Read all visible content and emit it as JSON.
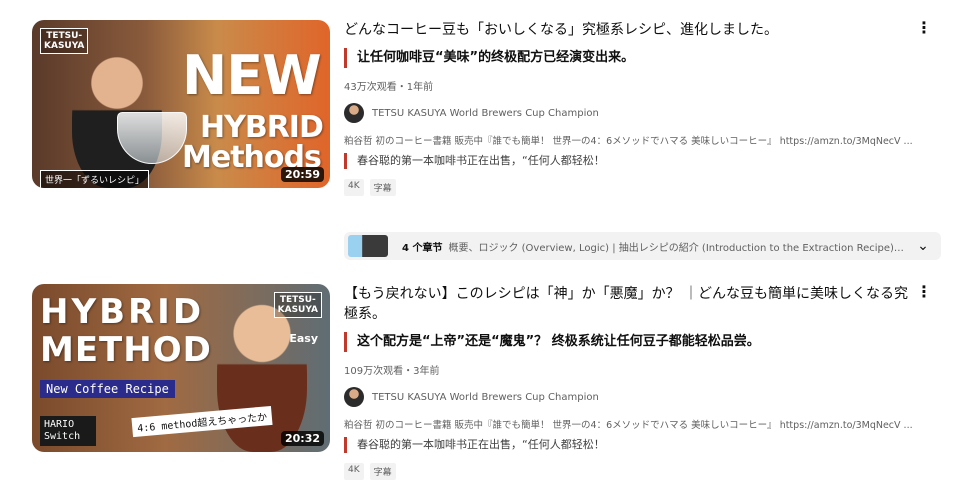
{
  "results": [
    {
      "thumbnail": {
        "brand_badge": "TETSU-\nKASUYA",
        "text_line1": "NEW",
        "text_line2": "HYBRID",
        "text_line3": "Methods",
        "caption": "世界一「ずるいレシピ」",
        "duration": "20:59"
      },
      "title": "どんなコーヒー豆も「おいしくなる」究極系レシピ、進化しました。",
      "quote": "让任何咖啡豆“美味”的终极配方已经演变出来。",
      "meta": "43万次观看・1年前",
      "channel": "TETSU KASUYA World Brewers Cup Champion",
      "description": "粕谷哲 初のコーヒー書籍 販売中『誰でも簡単！ 世界一の4：6メソッドでハマる 美味しいコーヒー』 https://amzn.to/3MqNecV ...",
      "description_zh": "春谷聪的第一本咖啡书正在出售，“任何人都轻松！",
      "tags": [
        "4K",
        "字幕"
      ],
      "chapters": {
        "count_label": "4 个章节",
        "text": "概要、ロジック (Overview, Logic) | 抽出レシピの紹介 (Introduction to the Extraction Recipe) | 味わい..."
      },
      "menu_icon": "⋮"
    },
    {
      "thumbnail": {
        "brand_badge": "TETSU-\nKASUYA",
        "text_line1": "HYBRID",
        "text_line2": "METHOD",
        "banner": "New Coffee Recipe",
        "hario": "HARIO\nSwitch",
        "overlay": "4:6 method超えちゃったか",
        "easy": "Easy",
        "duration": "20:32"
      },
      "title": "【もう戻れない】このレシピは「神」か「悪魔」か？ ｜どんな豆も簡単に美味しくなる究極系。",
      "quote": "这个配方是“上帝”还是“魔鬼”？ 终极系统让任何豆子都能轻松品尝。",
      "meta": "109万次观看・3年前",
      "channel": "TETSU KASUYA World Brewers Cup Champion",
      "description": "粕谷哲 初のコーヒー書籍 販売中『誰でも簡単！ 世界一の4：6メソッドでハマる 美味しいコーヒー』 https://amzn.to/3MqNecV ...",
      "description_zh": "春谷聪的第一本咖啡书正在出售，“任何人都轻松！",
      "tags": [
        "4K",
        "字幕"
      ],
      "menu_icon": "⋮"
    }
  ],
  "chevron_icon": "⌄"
}
